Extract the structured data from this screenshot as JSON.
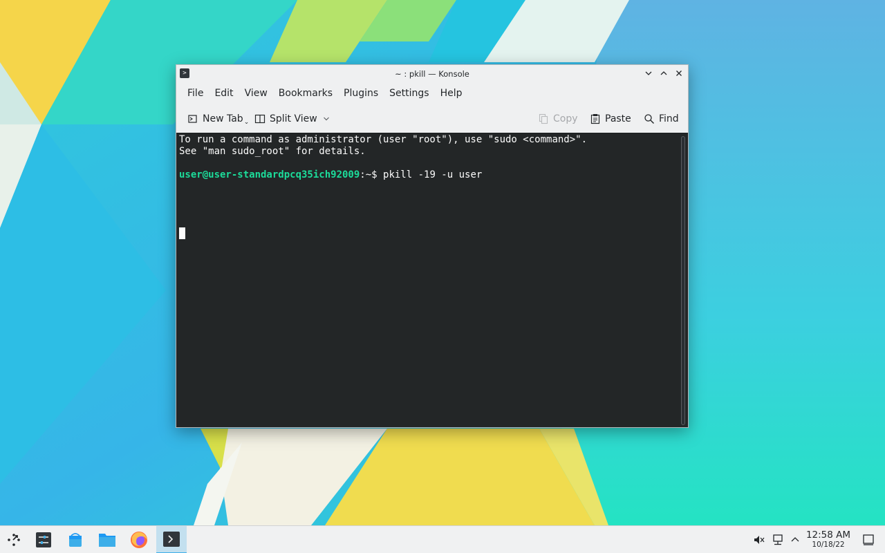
{
  "window": {
    "title": "~ : pkill — Konsole",
    "app_icon_glyph": ">"
  },
  "menubar": {
    "items": [
      "File",
      "Edit",
      "View",
      "Bookmarks",
      "Plugins",
      "Settings",
      "Help"
    ]
  },
  "toolbar": {
    "new_tab": "New Tab",
    "split_view": "Split View",
    "copy": "Copy",
    "paste": "Paste",
    "find": "Find"
  },
  "terminal": {
    "line1": "To run a command as administrator (user \"root\"), use \"sudo <command>\".",
    "line2": "See \"man sudo_root\" for details.",
    "prompt_user": "user@user-standardpcq35ich92009",
    "prompt_path": ":~$ ",
    "command": "pkill -19 -u user"
  },
  "taskbar": {
    "clock_time": "12:58 AM",
    "clock_date": "10/18/22"
  },
  "colors": {
    "terminal_bg": "#232627",
    "prompt_green": "#1cdc9a",
    "accent": "#3daee9"
  }
}
